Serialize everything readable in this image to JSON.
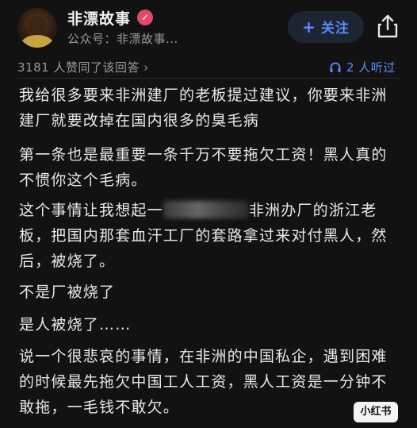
{
  "header": {
    "author_name": "非漂故事",
    "verified_badge": "✓",
    "sub_name": "公众号：非漂故事...",
    "follow_label": "关注",
    "follow_plus": "+",
    "share_icon": "share-icon",
    "accent_color": "#5b8cff"
  },
  "meta": {
    "likes_text": "3181 人赞同了该回答 ›",
    "listen_text": "2 人听过"
  },
  "article": {
    "p1": "我给很多要来非洲建厂的老板提过建议，你要来非洲建厂就要改掉在国内很多的臭毛病",
    "p2": "第一条也是最重要一条千万不要拖欠工资！黑人真的不惯你这个毛病。",
    "p3_before": "这个事情让我想起一",
    "p3_after": "非洲办厂的浙江老板，把国内那套血汗工厂的套路拿过来对付黑人，然后，被烧了。",
    "p4": "不是厂被烧了",
    "p5": "是人被烧了……",
    "p6": "说一个很悲哀的事情，在非洲的中国私企，遇到困难的时候最先拖欠中国工人工资，黑人工资是一分钟不敢拖，一毛钱不敢欠。"
  },
  "watermark": "小红书"
}
